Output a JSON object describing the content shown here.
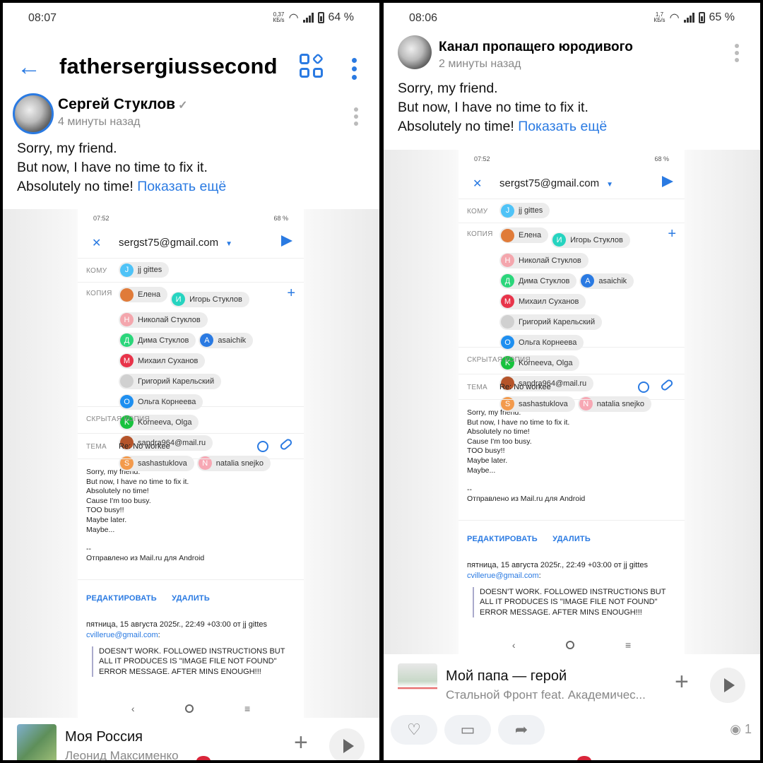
{
  "left": {
    "status": {
      "time": "08:07",
      "speed_value": "0,37",
      "speed_unit": "КБ/s",
      "battery": "64 %"
    },
    "header": {
      "channel": "fathersergiussecond"
    },
    "post": {
      "author": "Сергей Стуклов",
      "time": "4 минуты назад",
      "lines": [
        "Sorry, my friend.",
        "But now, I have no time to fix it.",
        "Absolutely no time!"
      ],
      "more": "Показать ещё"
    },
    "track": {
      "title": "Моя Россия",
      "artist": "Леонид Максименко"
    }
  },
  "right": {
    "status": {
      "time": "08:06",
      "speed_value": "1,7",
      "speed_unit": "КБ/s",
      "battery": "65 %"
    },
    "post": {
      "author": "Канал пропащего юродивого",
      "time": "2 минуты назад",
      "lines": [
        "Sorry, my friend.",
        "But now, I have no time to fix it.",
        "Absolutely no time!"
      ],
      "more": "Показать ещё"
    },
    "track": {
      "title": "Мой папа — герой",
      "artist": "Стальной Фронт feat. Академичес..."
    },
    "views": "1"
  },
  "mail": {
    "status_time": "07:52",
    "status_right": "68 %",
    "from": "sergst75@gmail.com",
    "to_label": "КОМУ",
    "to": [
      {
        "initial": "J",
        "name": "jj gittes",
        "color": "#4fc3f7"
      }
    ],
    "cc_label": "КОПИЯ",
    "cc": [
      {
        "initial": "",
        "name": "Елена",
        "color": "#e07b39"
      },
      {
        "initial": "И",
        "name": "Игорь Стуклов",
        "color": "#26d4c0"
      },
      {
        "initial": "Н",
        "name": "Николай Стуклов",
        "color": "#f4a6ad"
      },
      {
        "initial": "Д",
        "name": "Дима Стуклов",
        "color": "#2bd67b"
      },
      {
        "initial": "A",
        "name": "asaichik",
        "color": "#2a7ae2"
      },
      {
        "initial": "M",
        "name": "Михаил Суханов",
        "color": "#e8344a"
      },
      {
        "initial": "",
        "name": "Григорий Карельский",
        "color": "#d0d0d0"
      },
      {
        "initial": "O",
        "name": "Ольга Корнеева",
        "color": "#1e8ff0"
      },
      {
        "initial": "K",
        "name": "Korneeva, Olga",
        "color": "#18c23e"
      },
      {
        "initial": "",
        "name": "sandra964@mail.ru",
        "color": "#b5542a"
      },
      {
        "initial": "S",
        "name": "sashastuklova",
        "color": "#f39a4c"
      },
      {
        "initial": "N",
        "name": "natalia snejko",
        "color": "#f7a8b4"
      }
    ],
    "bcc_label": "СКРЫТАЯ КОПИЯ",
    "subject_label": "ТЕМА",
    "subject": "Re: No workee",
    "body": "Sorry, my friend.\nBut now, I have no time to fix it.\nAbsolutely no time!\nCause I'm too busy.\nTOO busy!!\nMaybe later.\nMaybe...\n\n--\nОтправлено из Mail.ru для Android",
    "edit": "РЕДАКТИРОВАТЬ",
    "delete": "УДАЛИТЬ",
    "quote_head": "пятница, 15 августа 2025г., 22:49 +03:00 от jj gittes",
    "quote_mail": "cvillerue@gmail.com",
    "quote_text": "DOESN'T WORK. FOLLOWED INSTRUCTIONS BUT ALL IT PRODUCES IS \"IMAGE FILE NOT FOUND\" ERROR MESSAGE. AFTER MINS ENOUGH!!!"
  },
  "icons": [
    "back-arrow-icon",
    "apps-grid-icon",
    "more-vertical-icon",
    "verified-check-icon",
    "close-icon",
    "send-icon",
    "alarm-icon",
    "attach-icon",
    "plus-icon",
    "play-icon",
    "like-icon",
    "comment-icon",
    "share-icon",
    "eye-icon"
  ],
  "colors": {
    "accent": "#2a7ae2",
    "muted": "#888888"
  }
}
